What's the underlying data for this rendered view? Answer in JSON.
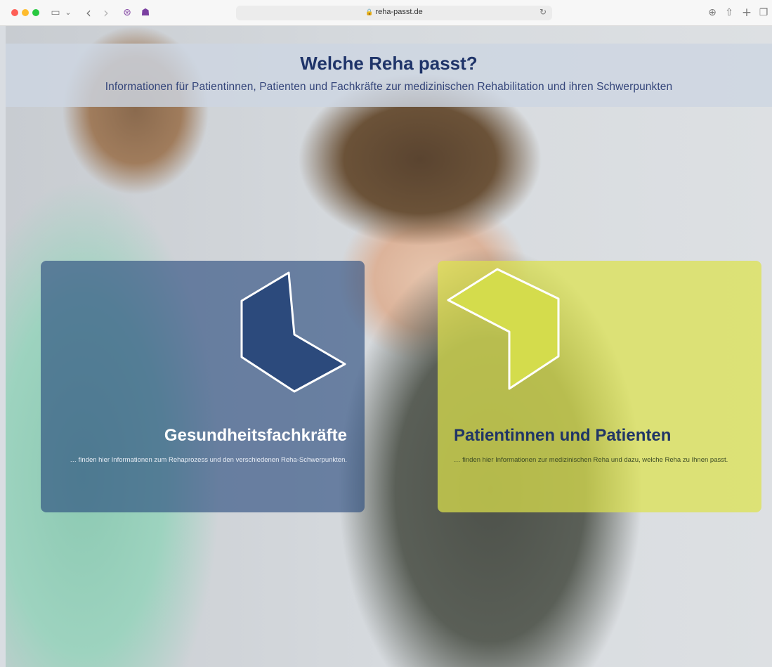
{
  "browser": {
    "url": "reha-passt.de",
    "icons": {
      "back": "‹",
      "forward": "›",
      "sidebar": "▭",
      "chevron": "⌄",
      "reload": "↻",
      "download": "⊕",
      "share": "⇧",
      "new_tab": "+",
      "tabs": "❐",
      "extension_1": "⊛",
      "extension_2": "☗",
      "lock": "🔒"
    }
  },
  "header": {
    "title": "Welche Reha passt?",
    "subtitle": "Informationen für Patientinnen, Patienten und Fachkräfte zur medizinischen Rehabilitation und ihren Schwerpunkten"
  },
  "cards": {
    "professionals": {
      "title": "Gesundheitsfachkräfte",
      "description": "… finden hier Informationen zum Rehaprozess und den verschiedenen Reha-Schwerpunkten."
    },
    "patients": {
      "title": "Patientinnen und Patienten",
      "description": "… finden hier Informationen zur medizinischen Reha und dazu, welche Reha zu Ihnen passt."
    }
  },
  "colors": {
    "brand_blue": "#1f3469",
    "card_blue": "#27487d",
    "card_yellow": "#dce24c",
    "logo_blue": "#2c4a7c",
    "logo_yellow": "#d4dc4c"
  }
}
